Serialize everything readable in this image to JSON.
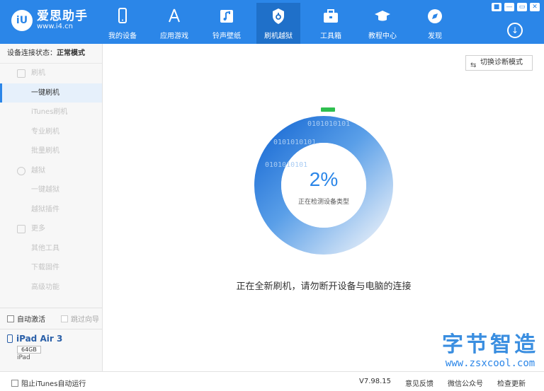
{
  "app": {
    "logo_badge": "iU",
    "name": "爱思助手",
    "url": "www.i4.cn"
  },
  "nav": [
    {
      "label": "我的设备",
      "icon": "phone-icon"
    },
    {
      "label": "应用游戏",
      "icon": "app-store-icon"
    },
    {
      "label": "铃声壁纸",
      "icon": "music-icon"
    },
    {
      "label": "刷机越狱",
      "icon": "shield-icon",
      "active": true
    },
    {
      "label": "工具箱",
      "icon": "toolbox-icon"
    },
    {
      "label": "教程中心",
      "icon": "graduation-cap-icon"
    },
    {
      "label": "发现",
      "icon": "compass-icon"
    }
  ],
  "window_buttons": [
    "■",
    "—",
    "▭",
    "✕"
  ],
  "download_glyph": "↓",
  "sidebar": {
    "status_label": "设备连接状态：",
    "status_value": "正常模式",
    "items": [
      {
        "label": "刷机",
        "section": true
      },
      {
        "label": "一键刷机",
        "selected": true
      },
      {
        "label": "iTunes刷机"
      },
      {
        "label": "专业刷机"
      },
      {
        "label": "批量刷机"
      },
      {
        "label": "越狱",
        "section": true
      },
      {
        "label": "一键越狱"
      },
      {
        "label": "越狱插件"
      },
      {
        "label": "更多",
        "section": true
      },
      {
        "label": "其他工具"
      },
      {
        "label": "下载固件"
      },
      {
        "label": "高级功能"
      }
    ],
    "auto_activate": "自动激活",
    "skip_guide": "跳过向导",
    "device": {
      "name": "iPad Air 3",
      "capacity": "64GB",
      "type": "iPad"
    }
  },
  "main": {
    "mode_button": "切换诊断模式",
    "mode_icon": "⇆",
    "progress_text": "2%",
    "progress_value": 0.02,
    "progress_sub": "正在检测设备类型",
    "binary_text": "0101010101",
    "message": "正在全新刷机，请勿断开设备与电脑的连接"
  },
  "watermark": {
    "cn": "字节智造",
    "en": "www.zsxcool.com"
  },
  "bottom": {
    "itunes_option": "阻止iTunes自动运行",
    "version": "V7.98.15",
    "feedback": "意见反馈",
    "wechat": "微信公众号",
    "update": "检查更新"
  },
  "colors": {
    "primary": "#2b86e8",
    "active_nav": "#1f70c9",
    "progress_green": "#2fbf4f"
  }
}
